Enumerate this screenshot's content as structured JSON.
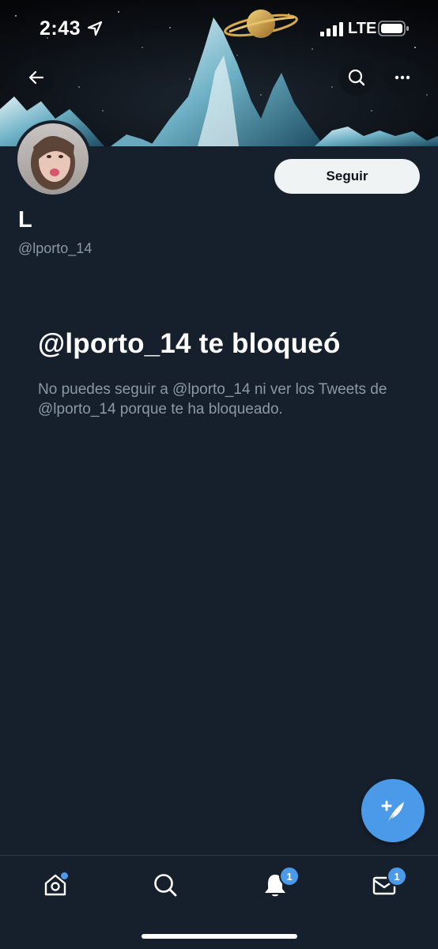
{
  "status_bar": {
    "time": "2:43",
    "network": "LTE"
  },
  "profile": {
    "display_name": "L",
    "username": "@lporto_14",
    "follow_label": "Seguir"
  },
  "blocked_notice": {
    "title": "@lporto_14 te bloqueó",
    "message": "No puedes seguir a @lporto_14 ni ver los Tweets de @lporto_14 porque te ha bloqueado."
  },
  "bottom_nav": {
    "items": [
      {
        "name": "home",
        "icon": "home-icon",
        "indicator": "dot"
      },
      {
        "name": "search",
        "icon": "search-icon"
      },
      {
        "name": "notifications",
        "icon": "bell-icon",
        "badge": "1"
      },
      {
        "name": "messages",
        "icon": "mail-icon",
        "badge": "1"
      }
    ]
  },
  "colors": {
    "background": "#16202c",
    "accent": "#4a9ae9",
    "secondary_text": "#8b98a5",
    "follow_button_bg": "#eff3f4"
  }
}
